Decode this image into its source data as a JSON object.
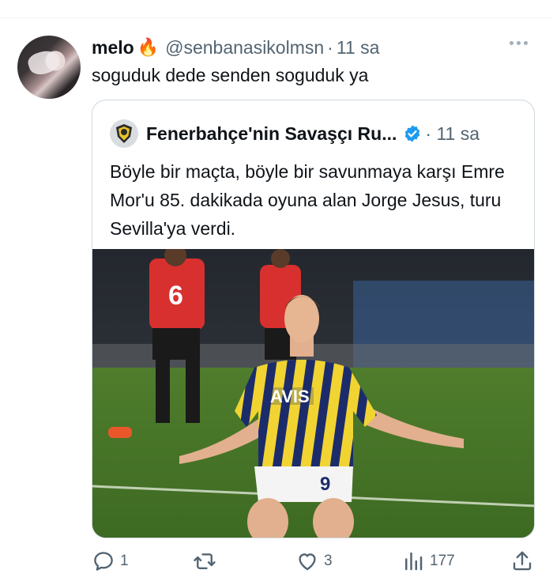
{
  "tweet": {
    "display_name": "melo",
    "name_emoji": "🔥",
    "handle": "@senbanasikolmsn",
    "separator": "·",
    "time": "11 sa",
    "text": "soguduk dede senden soguduk ya"
  },
  "quote": {
    "display_name": "Fenerbahçe'nin Savaşçı Ru...",
    "separator": "·",
    "time": "11 sa",
    "text": "Böyle bir maçta, böyle bir savunmaya karşı Emre Mor'u 85. dakikada oyuna alan Jorge Jesus, turu Sevilla'ya verdi.",
    "image": {
      "jersey_number_front": "6",
      "sponsor": "AVIS",
      "player_number": "9"
    }
  },
  "actions": {
    "reply_count": "1",
    "retweet_count": "",
    "like_count": "3",
    "views_count": "177"
  },
  "colors": {
    "text_primary": "#0f1419",
    "text_secondary": "#536471",
    "border": "#cfd9de",
    "verified": "#1d9bf0"
  },
  "icons": [
    "more-icon",
    "verified-badge-icon",
    "reply-icon",
    "retweet-icon",
    "like-icon",
    "views-icon",
    "share-icon"
  ]
}
